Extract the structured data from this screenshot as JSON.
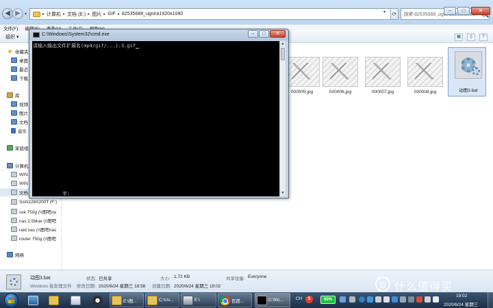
{
  "explorer": {
    "address_crumbs": [
      "计算机",
      "文档 (E:)",
      "图片",
      "GIF",
      "82535688_ugoira1920x1080"
    ],
    "search_placeholder": "搜索 82535688_ugoira1920x1080",
    "menu": [
      "文件(F)",
      "编辑(E)",
      "查看(V)",
      "工具(T)",
      "帮助(H)"
    ],
    "toolbar": {
      "organize": "组织 ▾"
    },
    "sidebar": {
      "items": [
        {
          "label": "收藏夹",
          "icon": "star-icon"
        },
        {
          "label": "桌面",
          "icon": "desktop-icon"
        },
        {
          "label": "最近",
          "icon": "recent-icon"
        },
        {
          "label": "下载",
          "icon": "downloads-icon"
        },
        {
          "label": "库",
          "icon": "library-icon"
        },
        {
          "label": "视频",
          "icon": "videos-icon"
        },
        {
          "label": "图片",
          "icon": "pictures-icon"
        },
        {
          "label": "文档",
          "icon": "documents-icon"
        },
        {
          "label": "音乐",
          "icon": "music-icon"
        },
        {
          "label": "家庭组",
          "icon": "homegroup-icon"
        },
        {
          "label": "计算机",
          "icon": "computer-icon"
        },
        {
          "label": "WIN",
          "icon": "drive-icon"
        },
        {
          "label": "WIN",
          "icon": "drive-icon"
        },
        {
          "label": "文档",
          "icon": "drive-icon"
        },
        {
          "label": "SAN128X200T (F:)",
          "icon": "drive-icon"
        },
        {
          "label": "ssk 750g (\\\\图吧na",
          "icon": "network-drive-icon"
        },
        {
          "label": "nas 2.5blue (\\\\图吧",
          "icon": "network-drive-icon"
        },
        {
          "label": "raid nas (\\\\图吧nas",
          "icon": "network-drive-icon"
        },
        {
          "label": "router 750g (\\\\图吧",
          "icon": "network-drive-icon"
        },
        {
          "label": "网络",
          "icon": "network-icon"
        }
      ]
    },
    "files": [
      {
        "name": "000005.jpg"
      },
      {
        "name": "000006.jpg"
      },
      {
        "name": "000007.jpg"
      },
      {
        "name": "000008.jpg"
      },
      {
        "name": "动图3.bat"
      }
    ],
    "details": {
      "name": "动图3.bat",
      "type": "Windows 批处理文件",
      "status_key": "状态:",
      "status_val": "已共享",
      "modified_key": "修改日期:",
      "modified_val": "2020/6/24 星期三 18:58",
      "created_key": "创建日期:",
      "created_val": "2020/6/24 星期三 19:02",
      "size_key": "大小:",
      "size_val": "1.72 KB",
      "shared_key": "共享设备:",
      "shared_val": "Everyone"
    }
  },
  "cmd": {
    "title": "C:\\Windows\\System32\\cmd.exe",
    "prompt": "请输入输出文件扩展名(mp4/gif/...):3.gif",
    "ime_line": "半:"
  },
  "taskbar": {
    "tasks": [
      {
        "label": "E:\\图..."
      },
      {
        "label": "C:\\Us..."
      },
      {
        "label": "E:\\"
      },
      {
        "label": "百度..."
      },
      {
        "label": "C:\\Wi..."
      }
    ],
    "tray": {
      "lang": "CH",
      "ime": "S",
      "battery": "89%",
      "time": "19:02",
      "date": "2020/6/24 星期三"
    }
  },
  "watermark": {
    "text": "什么值得买"
  }
}
